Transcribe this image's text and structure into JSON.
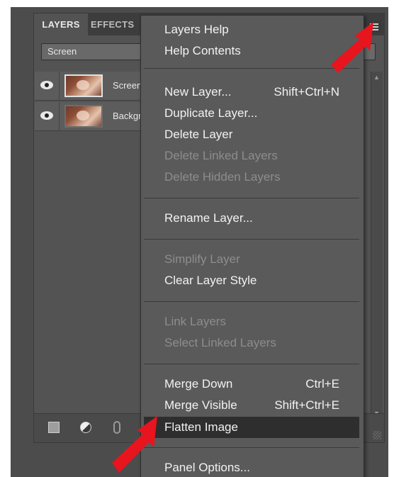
{
  "layers_panel": {
    "tabs": [
      {
        "label": "LAYERS"
      },
      {
        "label": "EFFECTS"
      }
    ],
    "blend_mode": "Screen",
    "layers": [
      {
        "name": "Screen",
        "visible": true
      },
      {
        "name": "Background",
        "visible": true
      }
    ],
    "icons": {
      "new_layer": "new-layer-icon",
      "adjustment": "adjustment-layer-icon",
      "link": "link-icon",
      "panel_menu": "panel-menu-icon",
      "visibility": "eye-icon"
    }
  },
  "context_menu": {
    "items": [
      {
        "label": "Layers Help",
        "shortcut": "",
        "enabled": true
      },
      {
        "label": "Help Contents",
        "shortcut": "",
        "enabled": true
      },
      {
        "label": "New Layer...",
        "shortcut": "Shift+Ctrl+N",
        "enabled": true
      },
      {
        "label": "Duplicate Layer...",
        "shortcut": "",
        "enabled": true
      },
      {
        "label": "Delete Layer",
        "shortcut": "",
        "enabled": true
      },
      {
        "label": "Delete Linked Layers",
        "shortcut": "",
        "enabled": false
      },
      {
        "label": "Delete Hidden Layers",
        "shortcut": "",
        "enabled": false
      },
      {
        "label": "Rename Layer...",
        "shortcut": "",
        "enabled": true
      },
      {
        "label": "Simplify Layer",
        "shortcut": "",
        "enabled": false
      },
      {
        "label": "Clear Layer Style",
        "shortcut": "",
        "enabled": true
      },
      {
        "label": "Link Layers",
        "shortcut": "",
        "enabled": false
      },
      {
        "label": "Select Linked Layers",
        "shortcut": "",
        "enabled": false
      },
      {
        "label": "Merge Down",
        "shortcut": "Ctrl+E",
        "enabled": true
      },
      {
        "label": "Merge Visible",
        "shortcut": "Shift+Ctrl+E",
        "enabled": true
      },
      {
        "label": "Flatten Image",
        "shortcut": "",
        "enabled": true,
        "highlighted": true
      },
      {
        "label": "Panel Options...",
        "shortcut": "",
        "enabled": true
      }
    ]
  },
  "colors": {
    "panel_bg": "#535353",
    "menu_bg": "#5a5a5a",
    "menu_highlight": "#2e2e2e",
    "menu_text": "#f2f2f2",
    "menu_text_disabled": "#8d8d8d",
    "annotation_arrow": "#e8141e"
  }
}
